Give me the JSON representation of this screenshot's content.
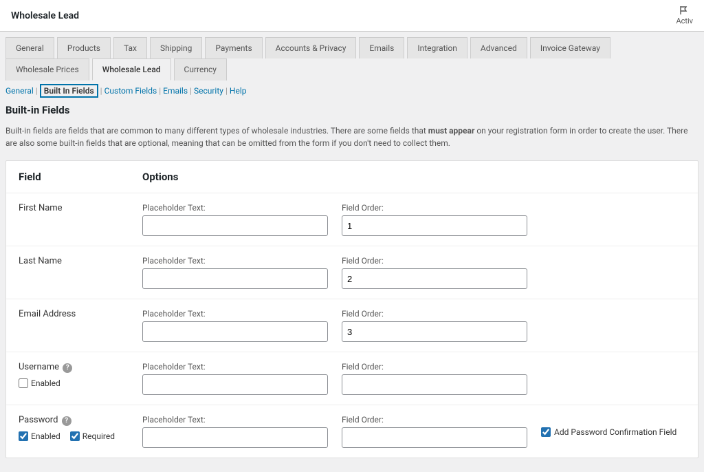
{
  "header": {
    "title": "Wholesale Lead",
    "activ_label": "Activ"
  },
  "main_tabs": [
    {
      "label": "General",
      "active": false
    },
    {
      "label": "Products",
      "active": false
    },
    {
      "label": "Tax",
      "active": false
    },
    {
      "label": "Shipping",
      "active": false
    },
    {
      "label": "Payments",
      "active": false
    },
    {
      "label": "Accounts & Privacy",
      "active": false
    },
    {
      "label": "Emails",
      "active": false
    },
    {
      "label": "Integration",
      "active": false
    },
    {
      "label": "Advanced",
      "active": false
    },
    {
      "label": "Invoice Gateway",
      "active": false
    },
    {
      "label": "Wholesale Prices",
      "active": false
    },
    {
      "label": "Wholesale Lead",
      "active": true
    },
    {
      "label": "Currency",
      "active": false
    }
  ],
  "sub_tabs": {
    "items": [
      "General",
      "Built In Fields",
      "Custom Fields",
      "Emails",
      "Security",
      "Help"
    ],
    "current": "Built In Fields"
  },
  "heading": "Built-in Fields",
  "description": {
    "before": "Built-in fields are fields that are common to many different types of wholesale industries. There are some fields that ",
    "bold": "must appear",
    "after": " on your registration form in order to create the user. There are also some built-in fields that are optional, meaning that can be omitted from the form if you don't need to collect them."
  },
  "columns": {
    "field": "Field",
    "options": "Options"
  },
  "labels": {
    "placeholder": "Placeholder Text:",
    "order": "Field Order:",
    "enabled": "Enabled",
    "required": "Required",
    "add_confirmation": "Add Password Confirmation Field"
  },
  "fields": [
    {
      "name": "First Name",
      "order": "1"
    },
    {
      "name": "Last Name",
      "order": "2"
    },
    {
      "name": "Email Address",
      "order": "3"
    },
    {
      "name": "Username",
      "order": "",
      "has_help": true,
      "enabled_chk": false
    },
    {
      "name": "Password",
      "order": "",
      "has_help": true,
      "enabled_chk": true,
      "required_chk": true,
      "confirmation": true
    }
  ]
}
